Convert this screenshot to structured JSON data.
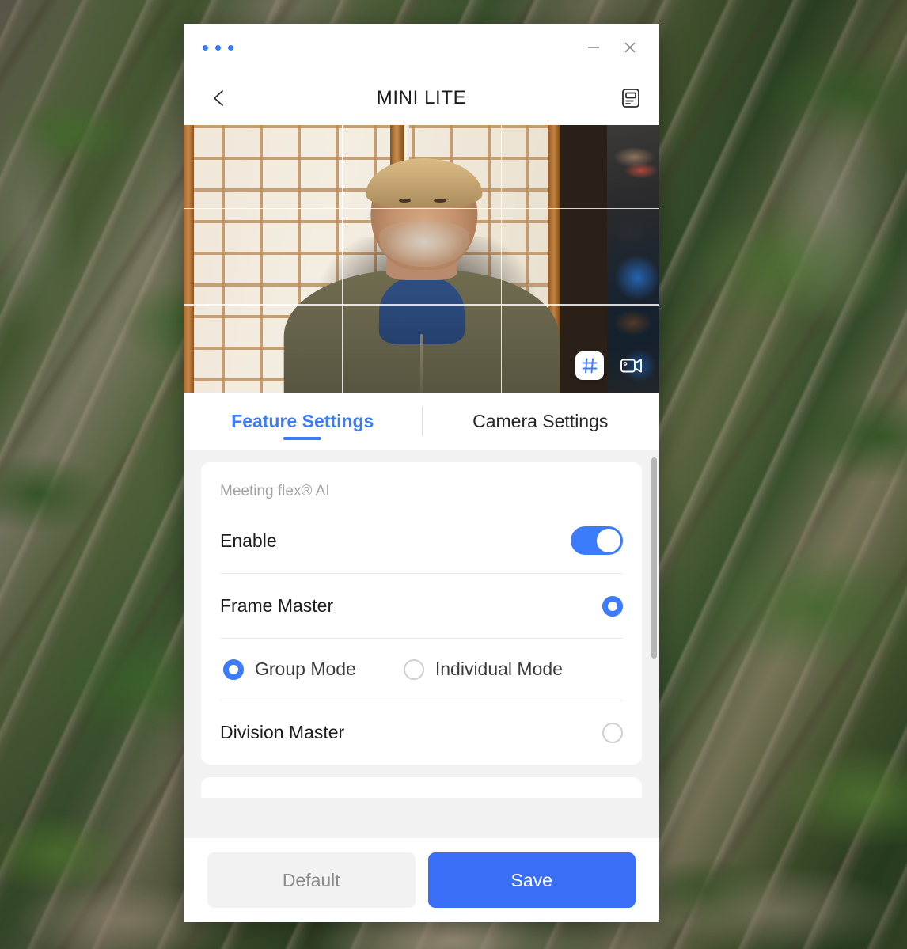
{
  "window": {
    "menu_dots_name": "more-options",
    "minimize_label": "Minimize",
    "close_label": "Close",
    "accent_blue": "#3b7bfc",
    "save_blue": "#3b6ef7"
  },
  "nav": {
    "back_label": "Back",
    "title": "MINI LITE",
    "right_icon_name": "device-info-icon"
  },
  "preview": {
    "grid_button_label": "Grid",
    "grid_active": true,
    "camera_button_label": "Camera",
    "description": "Live camera preview of a bearded man in an olive fleece over a blue shirt, seated in front of a shoji screen room divider, with a desk of equipment on the right"
  },
  "tabs": [
    {
      "label": "Feature Settings",
      "active": true
    },
    {
      "label": "Camera Settings",
      "active": false
    }
  ],
  "sections": [
    {
      "header": "Meeting flex® AI",
      "rows": [
        {
          "label": "Enable",
          "control": "toggle",
          "value": "on"
        },
        {
          "label": "Frame Master",
          "control": "radio",
          "value": "selected"
        },
        {
          "control": "mode-group",
          "options": [
            {
              "label": "Group Mode",
              "selected": true
            },
            {
              "label": "Individual Mode",
              "selected": false
            }
          ]
        },
        {
          "label": "Division Master",
          "control": "radio",
          "value": "unselected"
        }
      ]
    }
  ],
  "footer": {
    "default_label": "Default",
    "save_label": "Save"
  },
  "scrollbar": {
    "name": "settings-scrollbar",
    "position": "top"
  }
}
